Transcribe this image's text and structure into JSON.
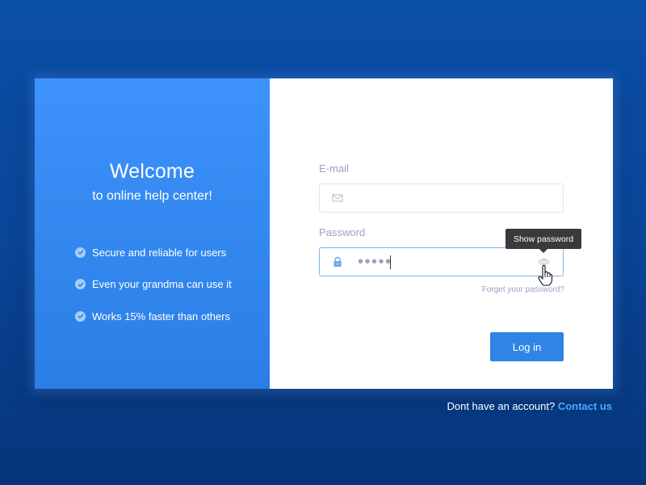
{
  "left_panel": {
    "title": "Welcome",
    "subtitle": "to online help center!",
    "features": [
      "Secure and reliable for users",
      "Even your grandma can use it",
      "Works 15% faster than others"
    ]
  },
  "form": {
    "email": {
      "label": "E-mail",
      "value": "",
      "placeholder": "",
      "icon": "mail-icon"
    },
    "password": {
      "label": "Password",
      "value": "•••••",
      "icon": "lock-icon"
    },
    "show_password_tooltip": "Show password",
    "forgot_password": "Forget your password?",
    "login_label": "Log in"
  },
  "footer": {
    "prompt": "Dont have an account?",
    "contact_link": "Contact us"
  },
  "colors": {
    "background": "#0a4597",
    "accent": "#2f84e6",
    "panel": "#3d93fb",
    "link": "#4aa8ff"
  }
}
